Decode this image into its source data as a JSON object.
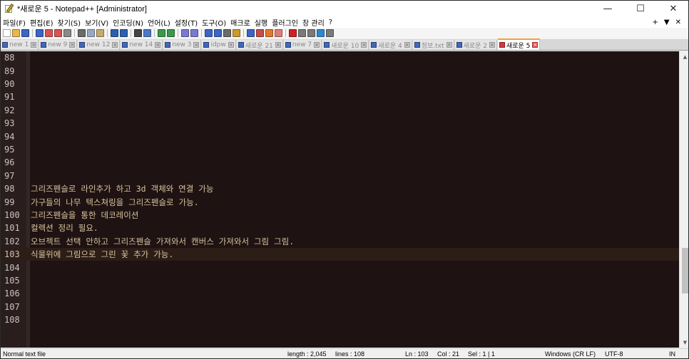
{
  "window": {
    "title": "*새로운 5 - Notepad++ [Administrator]",
    "controls": {
      "minimize": "—",
      "maximize": "☐",
      "close": "✕"
    }
  },
  "menu": {
    "items": [
      "파일(F)",
      "편집(E)",
      "찾기(S)",
      "보기(V)",
      "인코딩(N)",
      "언어(L)",
      "설정(T)",
      "도구(O)",
      "매크로",
      "실행",
      "플러그인",
      "창 관리",
      "?"
    ],
    "right": [
      "+",
      "▼",
      "✕"
    ]
  },
  "toolbar": {
    "icons": [
      "new-file-icon",
      "open-file-icon",
      "save-icon",
      "save-all-icon",
      "close-icon",
      "close-all-icon",
      "print-icon",
      "cut-icon",
      "copy-icon",
      "paste-icon",
      "undo-icon",
      "redo-icon",
      "find-icon",
      "replace-icon",
      "zoom-in-icon",
      "zoom-out-icon",
      "sync-v-icon",
      "sync-h-icon",
      "wrap-icon",
      "show-all-icon",
      "indent-guide-icon",
      "udl-icon",
      "doc-map-icon",
      "function-list-icon",
      "folder-workspace-icon",
      "monitor-icon",
      "record-macro-icon",
      "stop-macro-icon",
      "play-macro-icon",
      "run-multiple-icon",
      "save-macro-icon"
    ],
    "icon_colors": [
      "#ffffff",
      "#e8b84a",
      "#3a66c4",
      "#3a66c4",
      "#d9534f",
      "#d9534f",
      "#8a8a8a",
      "#6b6b6b",
      "#9aa8c8",
      "#c8a86b",
      "#2b5fb0",
      "#2b5fb0",
      "#444444",
      "#4a7ac7",
      "#3a9a4a",
      "#3a9a4a",
      "#7a7ad0",
      "#7a7ad0",
      "#3a66c4",
      "#3a66c4",
      "#6b6b6b",
      "#c89b2a",
      "#3a66c4",
      "#c84a4a",
      "#e07a2a",
      "#e07a7a",
      "#d02020",
      "#7a7a7a",
      "#7a7a7a",
      "#2a8ad0",
      "#7a7a7a"
    ]
  },
  "tabs": [
    {
      "label": "new 1",
      "active": false
    },
    {
      "label": "new 9",
      "active": false
    },
    {
      "label": "new 12",
      "active": false
    },
    {
      "label": "new 14",
      "active": false
    },
    {
      "label": "new 3",
      "active": false
    },
    {
      "label": "idpw",
      "active": false
    },
    {
      "label": "새로운 21",
      "active": false
    },
    {
      "label": "new 7",
      "active": false
    },
    {
      "label": "새로운 10",
      "active": false
    },
    {
      "label": "새로운 4",
      "active": false
    },
    {
      "label": "정보.txt",
      "active": false
    },
    {
      "label": "새로운 2",
      "active": false
    },
    {
      "label": "새로운 5",
      "active": true
    }
  ],
  "editor": {
    "lines": [
      {
        "n": "88",
        "text": ""
      },
      {
        "n": "89",
        "text": ""
      },
      {
        "n": "90",
        "text": ""
      },
      {
        "n": "91",
        "text": ""
      },
      {
        "n": "92",
        "text": ""
      },
      {
        "n": "93",
        "text": ""
      },
      {
        "n": "94",
        "text": ""
      },
      {
        "n": "95",
        "text": ""
      },
      {
        "n": "96",
        "text": ""
      },
      {
        "n": "97",
        "text": ""
      },
      {
        "n": "98",
        "text": "그리즈펜슬로 라인추가 하고 3d 객체와 연결 가능"
      },
      {
        "n": "99",
        "text": "가구들의 나무 텍스쳐링을 그리즈펜슬로 가능."
      },
      {
        "n": "100",
        "text": "그리즈펜슬을 통한 데코레이션"
      },
      {
        "n": "101",
        "text": "컬렉션 정리 필요."
      },
      {
        "n": "102",
        "text": "오브젝트 선택 안하고 그리즈펜슬 가져와서 캔버스 가져와서 그림 그림."
      },
      {
        "n": "103",
        "text": "식물위에 그림으로 그린 꽃 추가 가능.",
        "current": true
      },
      {
        "n": "104",
        "text": ""
      },
      {
        "n": "105",
        "text": ""
      },
      {
        "n": "106",
        "text": ""
      },
      {
        "n": "107",
        "text": ""
      },
      {
        "n": "108",
        "text": ""
      }
    ]
  },
  "status": {
    "file_type": "Normal text file",
    "length": "length : 2,045",
    "lines": "lines : 108",
    "ln": "Ln : 103",
    "col": "Col : 21",
    "sel": "Sel : 1 | 1",
    "eol": "Windows (CR LF)",
    "encoding": "UTF-8",
    "mode": "IN"
  }
}
